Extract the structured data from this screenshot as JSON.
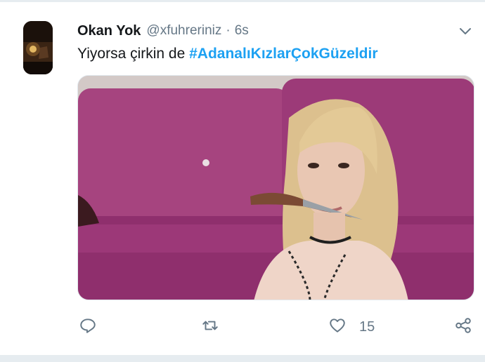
{
  "tweet": {
    "author_name": "Okan Yok",
    "handle": "@xfuhreriniz",
    "separator": "·",
    "time": "6s",
    "text": "Yiyorsa çirkin de ",
    "hashtag": "#AdanalıKızlarÇokGüzeldir",
    "like_count": "15"
  },
  "icons": {
    "more": "chevron-down-icon",
    "reply": "reply-icon",
    "retweet": "retweet-icon",
    "like": "heart-icon",
    "share": "share-icon"
  },
  "colors": {
    "hashtag": "#1da1f2",
    "secondary_text": "#657786",
    "sofa": "#a33a82"
  }
}
